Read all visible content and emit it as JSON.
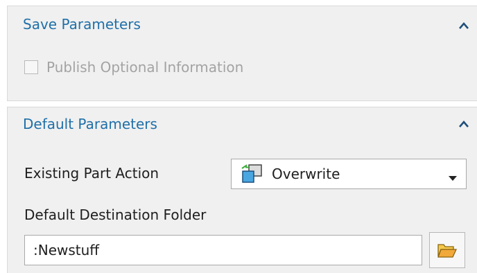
{
  "save_parameters": {
    "title": "Save Parameters",
    "publish_optional_label": "Publish Optional Information",
    "publish_optional_checked": false,
    "publish_optional_disabled": true
  },
  "default_parameters": {
    "title": "Default Parameters",
    "existing_part_action_label": "Existing Part Action",
    "existing_part_action_value": "Overwrite",
    "default_destination_label": "Default Destination Folder",
    "default_destination_value": ":Newstuff"
  },
  "icons": {
    "collapse": "chevron-up-icon",
    "overwrite": "overwrite-icon",
    "dropdown": "caret-down-icon",
    "browse": "folder-icon"
  },
  "colors": {
    "section_title": "#1f6fa8",
    "panel_bg": "#f0f0f0",
    "disabled_text": "#a3a3a3"
  }
}
